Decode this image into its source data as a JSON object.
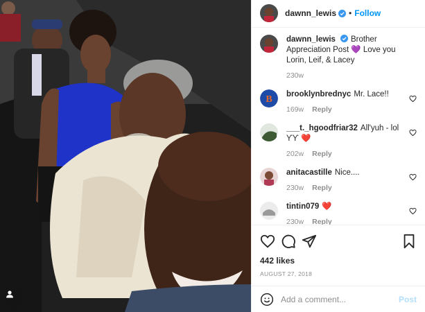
{
  "post": {
    "username": "dawnn_lewis",
    "follow_label": "Follow",
    "caption": "Brother Appreciation Post 💜 Love you Lorin, Leif, & Lacey",
    "caption_time": "230w",
    "likes": "442 likes",
    "date": "AUGUST 27, 2018"
  },
  "comments": [
    {
      "user": "brooklynbrednyc",
      "text": "Mr. Lace!!",
      "time": "169w",
      "reply": "Reply"
    },
    {
      "user": "___t._hgoodfriar32",
      "text": "All'yuh - lol ƳƳ ❤️",
      "time": "202w",
      "reply": "Reply"
    },
    {
      "user": "anitacastille",
      "text": "Nice....",
      "time": "230w",
      "reply": "Reply"
    },
    {
      "user": "tintin079",
      "text": "❤️",
      "time": "230w",
      "reply": "Reply"
    }
  ],
  "add_comment": {
    "placeholder": "Add a comment...",
    "post_label": "Post"
  },
  "icons": {
    "like": "heart-icon",
    "comment": "comment-icon",
    "share": "paper-plane-icon",
    "save": "bookmark-icon",
    "emoji": "emoji-icon",
    "tag": "user-tag-icon",
    "verified": "verified-badge-icon"
  },
  "colors": {
    "accent": "#0095f6",
    "verified": "#3897f0",
    "heart": "#ed4956",
    "muted": "#8e8e8e"
  }
}
